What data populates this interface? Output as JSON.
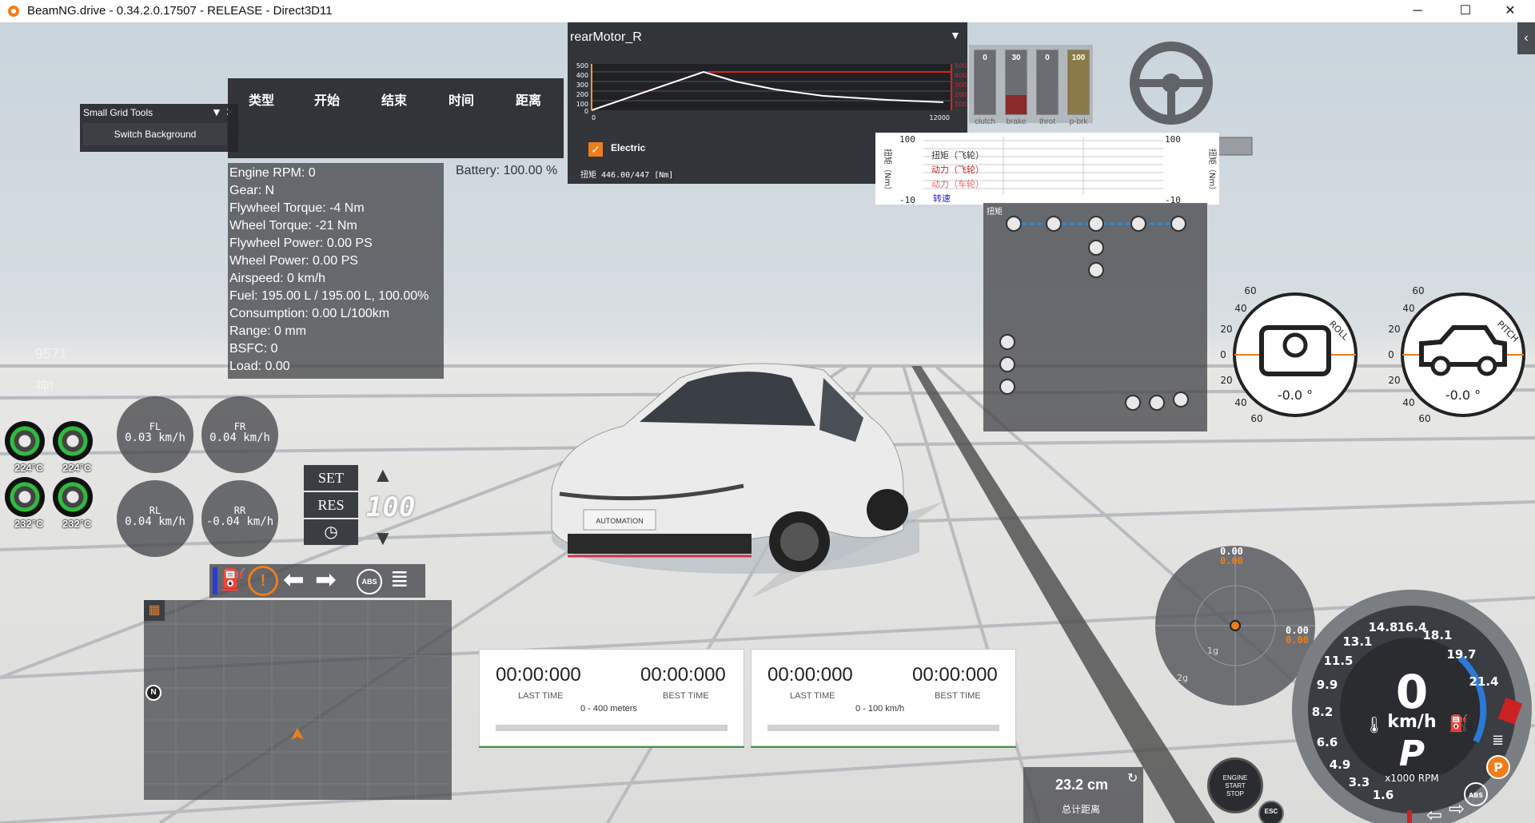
{
  "window": {
    "title": "BeamNG.drive - 0.34.2.0.17507 - RELEASE - Direct3D11",
    "minimize": "─",
    "maximize": "☐",
    "close": "✕"
  },
  "small_grid_tools": {
    "title": "Small Grid Tools",
    "button": "Switch Background"
  },
  "table_header": [
    "类型",
    "开始",
    "结束",
    "时间",
    "距离"
  ],
  "battery": "Battery: 100.00 %",
  "engine_info": [
    "Engine RPM: 0",
    "Gear: N",
    "Flywheel Torque: -4 Nm",
    "Wheel Torque: -21 Nm",
    "Flywheel Power: 0.00 PS",
    "Wheel Power: 0.00 PS",
    "Airspeed: 0 km/h",
    "Fuel: 195.00 L / 195.00 L, 100.00%",
    "Consumption: 0.00 L/100km",
    "Range: 0 mm",
    "BSFC: 0",
    "Load: 0.00"
  ],
  "motor_graph": {
    "title": "rearMotor_R",
    "left_ticks": [
      "500",
      "400",
      "300",
      "200",
      "100",
      "0"
    ],
    "right_ticks": [
      "500",
      "400",
      "300",
      "200",
      "100",
      "0"
    ],
    "x_start": "0",
    "x_end": "12000",
    "legend": "Electric",
    "torque_text": "扭矩 446.00/447 [Nm]"
  },
  "pedals": [
    {
      "name": "clutch",
      "value": "0",
      "level": 0
    },
    {
      "name": "brake",
      "value": "30",
      "level": 0.3
    },
    {
      "name": "throt",
      "value": "0",
      "level": 0
    },
    {
      "name": "p-brk",
      "value": "100",
      "level": 1.0
    }
  ],
  "force_graph": {
    "left_top": "100",
    "left_bottom": "-10",
    "right_top": "100",
    "right_bottom": "-10",
    "series": [
      "扭矩（飞轮）",
      "动力（飞轮）",
      "动力（车轮）"
    ],
    "extra": "转速",
    "left_axis": "扭矩（Nm）",
    "right_axis": "扭矩（Nm）"
  },
  "drivetrain_label": "扭矩",
  "tires": [
    {
      "temp": "224°C"
    },
    {
      "temp": "224°C"
    },
    {
      "temp": "232°C"
    },
    {
      "temp": "232°C"
    }
  ],
  "wheel_speeds": [
    {
      "name": "FL",
      "value": "0.03 km/h"
    },
    {
      "name": "FR",
      "value": "0.04 km/h"
    },
    {
      "name": "RL",
      "value": "0.04 km/h"
    },
    {
      "name": "RR",
      "value": "-0.04 km/h"
    }
  ],
  "cruise": {
    "set": "SET",
    "res": "RES",
    "speed": "100"
  },
  "faded": {
    "a": "9571",
    "b": "神!"
  },
  "timers": [
    {
      "last": "00:00:000",
      "best": "00:00:000",
      "last_label": "LAST TIME",
      "best_label": "BEST TIME",
      "desc": "0 - 400 meters"
    },
    {
      "last": "00:00:000",
      "best": "00:00:000",
      "last_label": "LAST TIME",
      "best_label": "BEST TIME",
      "desc": "0 - 100 km/h"
    }
  ],
  "distance": {
    "value": "23.2 cm",
    "label": "总计距离"
  },
  "roll": {
    "label": "ROLL",
    "value": "-0.0 °",
    "ticks": [
      "60",
      "40",
      "20",
      "0",
      "20",
      "40",
      "60"
    ]
  },
  "pitch": {
    "label": "PITCH",
    "value": "-0.0 °",
    "ticks": [
      "60",
      "40",
      "20",
      "0",
      "20",
      "40",
      "60"
    ]
  },
  "gforce": {
    "top1": "0.00",
    "top2": "0.00",
    "right1": "0.00",
    "right2": "0.00",
    "ring1": "1g",
    "ring2": "2g"
  },
  "gauge": {
    "speed": "0",
    "unit": "km/h",
    "gear": "P",
    "rpm_unit": "x1000 RPM",
    "rpm_marks": [
      "1.6",
      "3.3",
      "4.9",
      "6.6",
      "8.2",
      "9.9",
      "11.5",
      "13.1",
      "14.8",
      "16.4",
      "18.1",
      "19.7",
      "21.4"
    ],
    "park": "P"
  },
  "engine_button": [
    "ENGINE",
    "START",
    "STOP"
  ],
  "esc": "ESC",
  "compass_n": "N",
  "colors": {
    "accent": "#f08a24",
    "panel": "#4a4d52",
    "green": "#3e9a4a",
    "red": "#e02020"
  }
}
